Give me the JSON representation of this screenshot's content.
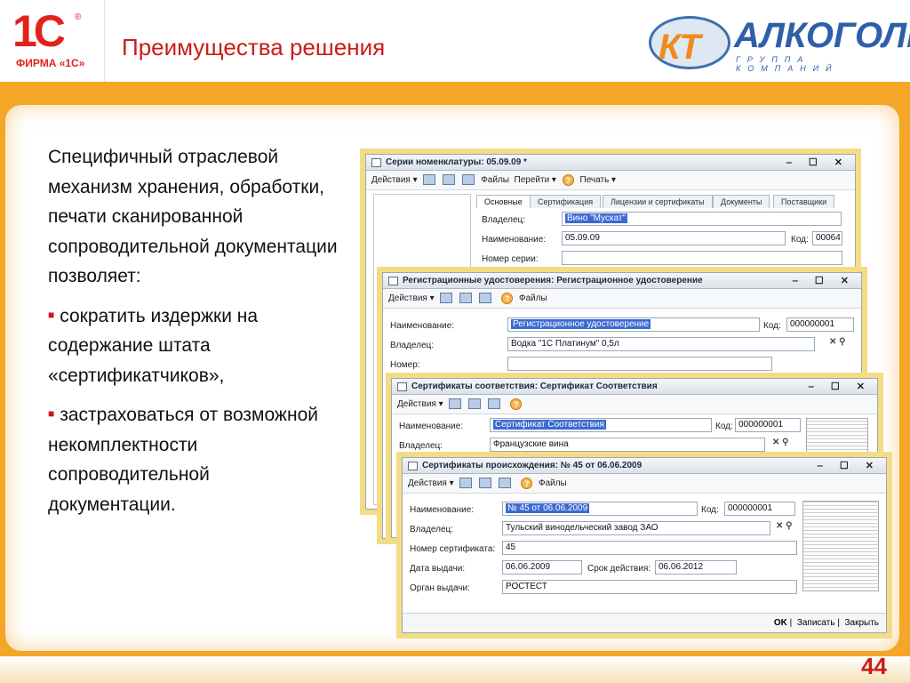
{
  "header": {
    "logo_mark": "1С",
    "logo_reg": "®",
    "logo_sub": "ФИРМА «1С»",
    "title": "Преимущества решения",
    "partner_badge": "КТ",
    "partner_name": "АЛКОГОЛЬ",
    "partner_sub": "ГРУППА КОМПАНИЙ"
  },
  "text": {
    "intro": "Специфичный отраслевой механизм хранения, обработки, печати сканированной сопроводительной документации позволяет:",
    "bullet1": "сократить издержки на содержание штата «сертификатчиков»,",
    "bullet2": "застраховаться от возможной некомплектности сопроводительной документации."
  },
  "page_number": "44",
  "win1": {
    "title": "Серии номенклатуры: 05.09.09 *",
    "actions": "Действия ▾",
    "files": "Файлы",
    "goto": "Перейти ▾",
    "print": "Печать ▾",
    "tabs": [
      "Основные",
      "Сертификация",
      "Лицензии и сертификаты",
      "Документы",
      "Поставщики"
    ],
    "owner_label": "Владелец:",
    "owner_value": "Вино \"Мускат\"",
    "name_label": "Наименование:",
    "name_value": "05.09.09",
    "code_label": "Код:",
    "code_value": "00064",
    "serial_label": "Номер серии:"
  },
  "win2": {
    "title": "Регистрационные удостоверения: Регистрационное удостоверение",
    "actions": "Действия ▾",
    "files": "Файлы",
    "name_label": "Наименование:",
    "name_value": "Регистрационное удостоверение",
    "code_label": "Код:",
    "code_value": "000000001",
    "owner_label": "Владелец:",
    "owner_value": "Водка \"1С Платинум\" 0,5л",
    "number_label": "Номер:"
  },
  "win3": {
    "title": "Сертификаты соответствия: Сертификат Соответствия",
    "actions": "Действия ▾",
    "name_label": "Наименование:",
    "name_value": "Сертификат Соответствия",
    "code_label": "Код:",
    "code_value": "000000001",
    "owner_label": "Владелец:",
    "owner_value": "Французские вина"
  },
  "win4": {
    "title": "Сертификаты происхождения: № 45 от 06.06.2009",
    "actions": "Действия ▾",
    "files": "Файлы",
    "name_label": "Наименование:",
    "name_value": "№ 45 от 06.06.2009",
    "code_label": "Код:",
    "code_value": "000000001",
    "owner_label": "Владелец:",
    "owner_value": "Тульский винодельческий завод ЗАО",
    "cert_label": "Номер сертификата:",
    "cert_value": "45",
    "issue_label": "Дата выдачи:",
    "issue_value": "06.06.2009",
    "valid_label": "Срок действия:",
    "valid_value": "06.06.2012",
    "org_label": "Орган выдачи:",
    "org_value": "РОСТЕСТ",
    "ok": "OK",
    "save": "Записать",
    "close": "Закрыть"
  },
  "window_controls": "‒ ☐ ✕",
  "colors": {
    "brand_red": "#cc1b16",
    "band_orange": "#f3a628",
    "highlight": "#3c6ad2"
  }
}
